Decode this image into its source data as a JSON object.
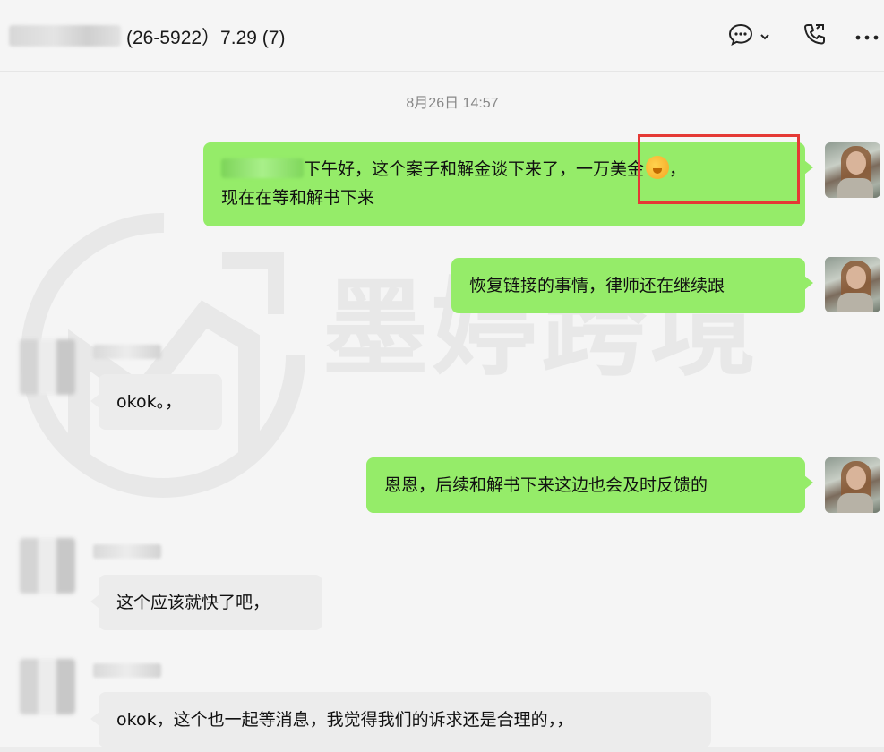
{
  "header": {
    "title_suffix": "(26-5922）7.29 (7)"
  },
  "chat": {
    "timestamp": "8月26日 14:57",
    "watermark": "墨婷跨境",
    "messages": [
      {
        "sender": "me",
        "text_part1": "下午好，这个案子和解金谈下来了，",
        "highlighted": "一万美金",
        "text_part2": "，",
        "line2": "现在在等和解书下来"
      },
      {
        "sender": "me",
        "text": "恢复链接的事情，律师还在继续跟"
      },
      {
        "sender": "other",
        "text": "okok。，"
      },
      {
        "sender": "me",
        "text": "恩恩，后续和解书下来这边也会及时反馈的"
      },
      {
        "sender": "other",
        "text": "这个应该就快了吧，"
      },
      {
        "sender": "other",
        "text": "okok，这个也一起等消息，我觉得我们的诉求还是合理的，，"
      }
    ]
  },
  "icons": {
    "chat": "chat-bubble-icon",
    "dropdown": "chevron-down-icon",
    "call": "phone-call-icon",
    "more": "more-dots-icon"
  },
  "colors": {
    "my_bubble": "#95ec69",
    "other_bubble": "#ececec",
    "highlight": "#e53935",
    "background": "#f5f5f5"
  }
}
